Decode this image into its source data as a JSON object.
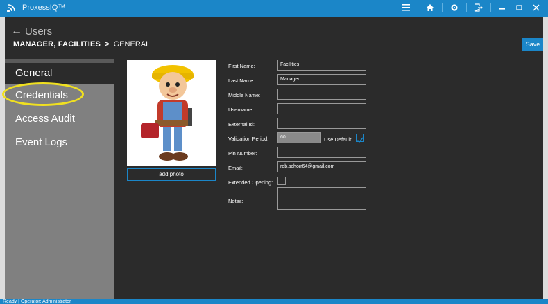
{
  "window": {
    "title": "ProxessIQ™"
  },
  "header": {
    "back_label": "Users",
    "breadcrumb_primary": "MANAGER, FACILITIES",
    "breadcrumb_separator": ">",
    "breadcrumb_secondary": "GENERAL",
    "save_label": "Save"
  },
  "sidebar": {
    "items": [
      {
        "label": "General",
        "active": true
      },
      {
        "label": "Credentials",
        "highlighted": true
      },
      {
        "label": "Access Audit"
      },
      {
        "label": "Event Logs"
      }
    ]
  },
  "photo": {
    "add_label": "add photo"
  },
  "form": {
    "first_name": {
      "label": "First Name:",
      "value": "Facilities"
    },
    "last_name": {
      "label": "Last Name:",
      "value": "Manager"
    },
    "middle_name": {
      "label": "Middle Name:",
      "value": ""
    },
    "username": {
      "label": "Username:",
      "value": ""
    },
    "external_id": {
      "label": "External Id:",
      "value": ""
    },
    "validation_period": {
      "label": "Validation Period:",
      "value": "60",
      "use_default_label": "Use Default:",
      "use_default_checked": true
    },
    "pin_number": {
      "label": "Pin Number:",
      "value": ""
    },
    "email": {
      "label": "Email:",
      "value": "rob.schorr64@gmail.com"
    },
    "extended_opening": {
      "label": "Extended Opening:",
      "checked": false
    },
    "notes": {
      "label": "Notes:",
      "value": ""
    }
  },
  "status": {
    "text": "Ready  |  Operator: Administrator"
  },
  "colors": {
    "accent": "#1b86c8",
    "panel": "#2b2b2b",
    "sidebar": "#808080",
    "highlight": "#f0e020"
  }
}
